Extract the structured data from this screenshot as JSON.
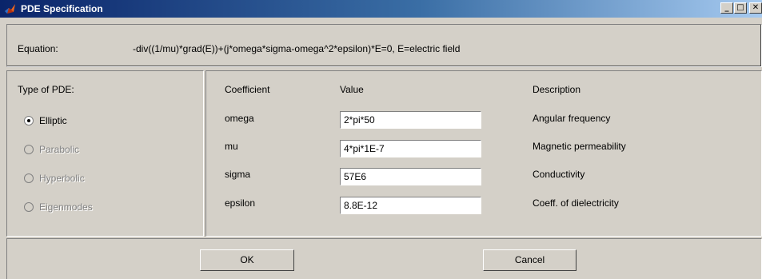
{
  "window": {
    "title": "PDE Specification",
    "minimize": "_",
    "maximize": "□",
    "close": "✕"
  },
  "equation": {
    "label": "Equation:",
    "text": "-div((1/mu)*grad(E))+(j*omega*sigma-omega^2*epsilon)*E=0, E=electric field"
  },
  "pde_type": {
    "label": "Type of PDE:",
    "options": [
      {
        "label": "Elliptic",
        "selected": true,
        "enabled": true
      },
      {
        "label": "Parabolic",
        "selected": false,
        "enabled": false
      },
      {
        "label": "Hyperbolic",
        "selected": false,
        "enabled": false
      },
      {
        "label": "Eigenmodes",
        "selected": false,
        "enabled": false
      }
    ]
  },
  "coefficients": {
    "headers": {
      "coefficient": "Coefficient",
      "value": "Value",
      "description": "Description"
    },
    "rows": [
      {
        "name": "omega",
        "value": "2*pi*50",
        "description": "Angular frequency"
      },
      {
        "name": "mu",
        "value": "4*pi*1E-7",
        "description": "Magnetic permeability"
      },
      {
        "name": "sigma",
        "value": "57E6",
        "description": "Conductivity"
      },
      {
        "name": "epsilon",
        "value": "8.8E-12",
        "description": "Coeff. of dielectricity"
      }
    ]
  },
  "buttons": {
    "ok": "OK",
    "cancel": "Cancel"
  },
  "colors": {
    "face": "#d4d0c8",
    "titlebar_start": "#0a246a",
    "titlebar_end": "#a6caf0",
    "disabled_text": "#808080"
  }
}
